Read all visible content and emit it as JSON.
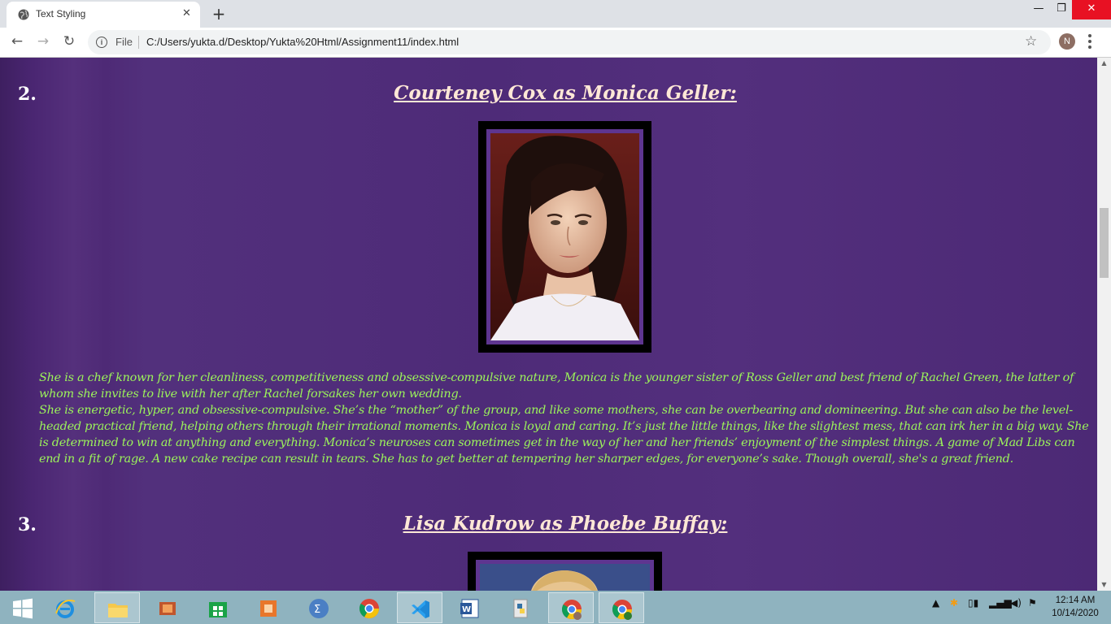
{
  "browser": {
    "tab_title": "Text Styling",
    "file_label": "File",
    "url": "C:/Users/yukta.d/Desktop/Yukta%20Html/Assignment11/index.html",
    "profile_initial": "N"
  },
  "page": {
    "items": [
      {
        "number": "2.",
        "heading": "Courteney Cox as Monica Geller:",
        "bio": [
          "She is a chef known for her cleanliness, competitiveness and obsessive-compulsive nature, Monica is the younger sister of Ross Geller and best friend of Rachel Green, the latter of whom she invites to live with her after Rachel forsakes her own wedding.",
          "She is energetic, hyper, and obsessive-compulsive. She’s the “mother” of the group, and like some mothers, she can be overbearing and domineering. But she can also be the level-headed practical friend, helping others through their irrational moments. Monica is loyal and caring. It’s just the little things, like the slightest mess, that can irk her in a big way. She is determined to win at anything and everything. Monica’s neuroses can sometimes get in the way of her and her friends’ enjoyment of the simplest things. A game of Mad Libs can end in a fit of rage. A new cake recipe can result in tears. She has to get better at tempering her sharper edges, for everyone’s sake. Though overall, she's a great friend."
        ]
      },
      {
        "number": "3.",
        "heading": "Lisa Kudrow as Phoebe Buffay:"
      }
    ]
  },
  "taskbar": {
    "time": "12:14 AM",
    "date": "10/14/2020",
    "apps": [
      "start",
      "internet-explorer",
      "file-explorer",
      "video-editor",
      "store",
      "office-tool",
      "math-input",
      "chrome",
      "vscode",
      "word",
      "python",
      "chrome-profile-n",
      "chrome-profile-y"
    ]
  },
  "colors": {
    "page_bg": "#4f2b78",
    "heading": "#ffe8d6",
    "bio_text": "#9cf45a",
    "photo_frame": "#000000",
    "photo_mat": "#5e3590"
  }
}
